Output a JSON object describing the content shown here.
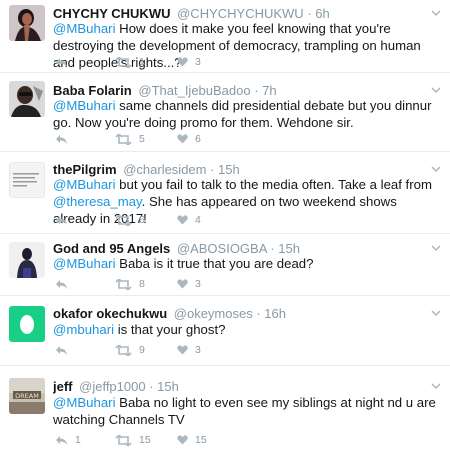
{
  "tweets": [
    {
      "name": "CHYCHY CHUKWU",
      "handle": "@CHYCHYCHUKWU",
      "time": "6h",
      "mention": "@MBuhari",
      "text": " How does it make you feel knowing that you're destroying the development of democracy, trampling on human and people's rights...?",
      "mention2": "",
      "text2": "",
      "reply_count": "",
      "retweet_count": "1",
      "like_count": "3",
      "avatar_icon": "woman-profile-photo"
    },
    {
      "name": "Baba Folarin",
      "handle": "@That_IjebuBadoo",
      "time": "7h",
      "mention": "@MBuhari",
      "text": " same channels did presidential debate but you dinnur go. Now you're doing promo for them. Wehdone sir.",
      "mention2": "",
      "text2": "",
      "reply_count": "",
      "retweet_count": "5",
      "like_count": "6",
      "avatar_icon": "man-profile-photo"
    },
    {
      "name": "thePilgrim",
      "handle": "@charlesidem",
      "time": "15h",
      "mention": "@MBuhari",
      "text": " but you fail to talk to the media often. Take a leaf from ",
      "mention2": "@theresa_may",
      "text2": ". She has appeared on two weekend shows already in 2017!",
      "reply_count": "",
      "retweet_count": "6",
      "like_count": "4",
      "avatar_icon": "text-card-photo"
    },
    {
      "name": "God and 95 Angels",
      "handle": "@ABOSIOGBA",
      "time": "15h",
      "mention": "@MBuhari",
      "text": " Baba is it true that you are dead?",
      "mention2": "",
      "text2": "",
      "reply_count": "",
      "retweet_count": "8",
      "like_count": "3",
      "avatar_icon": "silhouette-photo"
    },
    {
      "name": "okafor okechukwu",
      "handle": "@okeymoses",
      "time": "16h",
      "mention": "@mbuhari",
      "text": " is that your ghost?",
      "mention2": "",
      "text2": "",
      "reply_count": "",
      "retweet_count": "9",
      "like_count": "3",
      "avatar_icon": "default-egg-avatar"
    },
    {
      "name": "jeff",
      "handle": "@jeffp1000",
      "time": "15h",
      "mention": "@MBuhari",
      "text": " Baba no light to even see my siblings at night nd u are watching Channels TV",
      "mention2": "",
      "text2": "",
      "reply_count": "1",
      "retweet_count": "15",
      "like_count": "15",
      "avatar_icon": "dream-sign-photo"
    }
  ],
  "separator": " · ",
  "colors": {
    "link": "#1b95e0",
    "muted": "#8899a6",
    "egg_avatar": "#19cf86"
  }
}
